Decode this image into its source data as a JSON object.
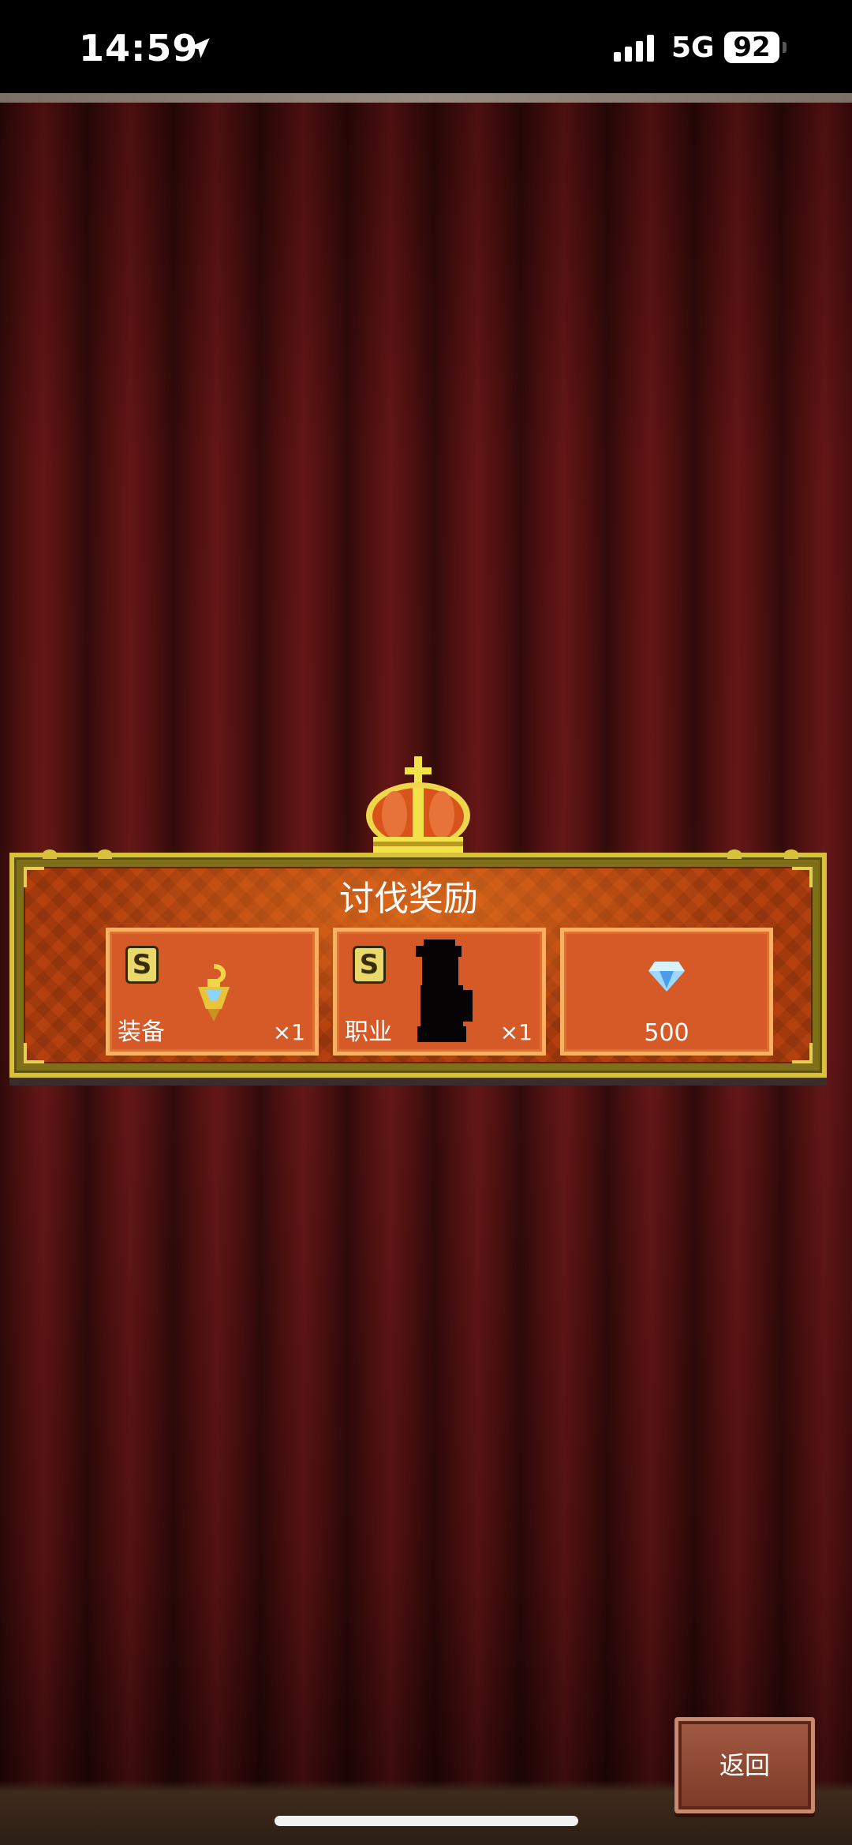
{
  "status_bar": {
    "time": "14:59",
    "network": "5G",
    "battery": "92",
    "location_icon": "location-arrow-icon",
    "signal_icon": "cellular-signal-icon"
  },
  "reward_panel": {
    "title": "讨伐奖励",
    "rewards": [
      {
        "rank": "S",
        "label": "装备",
        "quantity": "×1",
        "icon": "gold-pendant-icon"
      },
      {
        "rank": "S",
        "label": "职业",
        "quantity": "×1",
        "icon": "character-silhouette-icon"
      },
      {
        "amount": "500",
        "icon": "diamond-gem-icon"
      }
    ]
  },
  "buttons": {
    "back": "返回"
  },
  "colors": {
    "curtain": "#5a1212",
    "panel_orange": "#b4400e",
    "card_orange": "#d65a28",
    "gold": "#d9c23b"
  }
}
